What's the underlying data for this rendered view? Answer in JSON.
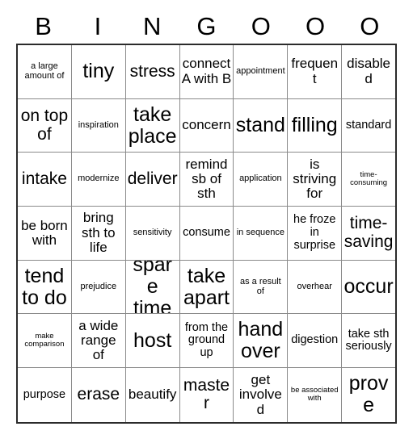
{
  "card": {
    "title_letters": [
      "B",
      "I",
      "N",
      "G",
      "O",
      "O",
      "O"
    ],
    "columns": 7,
    "rows": 7,
    "colors": {
      "outer_border": "#2b2b2b",
      "inner_border": "#8a8a8a",
      "cell_background": "#ffffff",
      "text": "#000000",
      "page_background": "#ffffff"
    },
    "cells": [
      [
        {
          "text": "a large amount of",
          "size": "xs"
        },
        {
          "text": "tiny",
          "size": "xl"
        },
        {
          "text": "stress",
          "size": "lg"
        },
        {
          "text": "connect A with B",
          "size": "md"
        },
        {
          "text": "appointment",
          "size": "xs"
        },
        {
          "text": "frequent",
          "size": "md"
        },
        {
          "text": "disabled",
          "size": "md"
        }
      ],
      [
        {
          "text": "on top of",
          "size": "lg"
        },
        {
          "text": "inspiration",
          "size": "xs"
        },
        {
          "text": "take place",
          "size": "xl"
        },
        {
          "text": "concern",
          "size": "md"
        },
        {
          "text": "stand",
          "size": "xl"
        },
        {
          "text": "filling",
          "size": "xl"
        },
        {
          "text": "standard",
          "size": "sm"
        }
      ],
      [
        {
          "text": "intake",
          "size": "lg"
        },
        {
          "text": "modernize",
          "size": "xs"
        },
        {
          "text": "deliver",
          "size": "lg"
        },
        {
          "text": "remind sb of sth",
          "size": "md"
        },
        {
          "text": "application",
          "size": "xs"
        },
        {
          "text": "is striving for",
          "size": "md"
        },
        {
          "text": "time-consuming",
          "size": "xxs"
        }
      ],
      [
        {
          "text": "be born with",
          "size": "md"
        },
        {
          "text": "bring sth to life",
          "size": "md"
        },
        {
          "text": "sensitivity",
          "size": "xs"
        },
        {
          "text": "consume",
          "size": "sm"
        },
        {
          "text": "in sequence",
          "size": "xs"
        },
        {
          "text": "he froze in surprise",
          "size": "sm"
        },
        {
          "text": "time-saving",
          "size": "lg"
        }
      ],
      [
        {
          "text": "tend to do",
          "size": "xl"
        },
        {
          "text": "prejudice",
          "size": "xs"
        },
        {
          "text": "spare time",
          "size": "xl"
        },
        {
          "text": "take apart",
          "size": "xl"
        },
        {
          "text": "as a result of",
          "size": "xs"
        },
        {
          "text": "overhear",
          "size": "xs"
        },
        {
          "text": "occur",
          "size": "xl"
        }
      ],
      [
        {
          "text": "make comparison",
          "size": "xxs"
        },
        {
          "text": "a wide range of",
          "size": "md"
        },
        {
          "text": "host",
          "size": "xl"
        },
        {
          "text": "from the ground up",
          "size": "sm"
        },
        {
          "text": "hand over",
          "size": "xl"
        },
        {
          "text": "digestion",
          "size": "sm"
        },
        {
          "text": "take sth seriously",
          "size": "sm"
        }
      ],
      [
        {
          "text": "purpose",
          "size": "sm"
        },
        {
          "text": "erase",
          "size": "lg"
        },
        {
          "text": "beautify",
          "size": "md"
        },
        {
          "text": "master",
          "size": "lg"
        },
        {
          "text": "get involved",
          "size": "md"
        },
        {
          "text": "be associated with",
          "size": "xxs"
        },
        {
          "text": "prove",
          "size": "xl"
        }
      ]
    ]
  }
}
